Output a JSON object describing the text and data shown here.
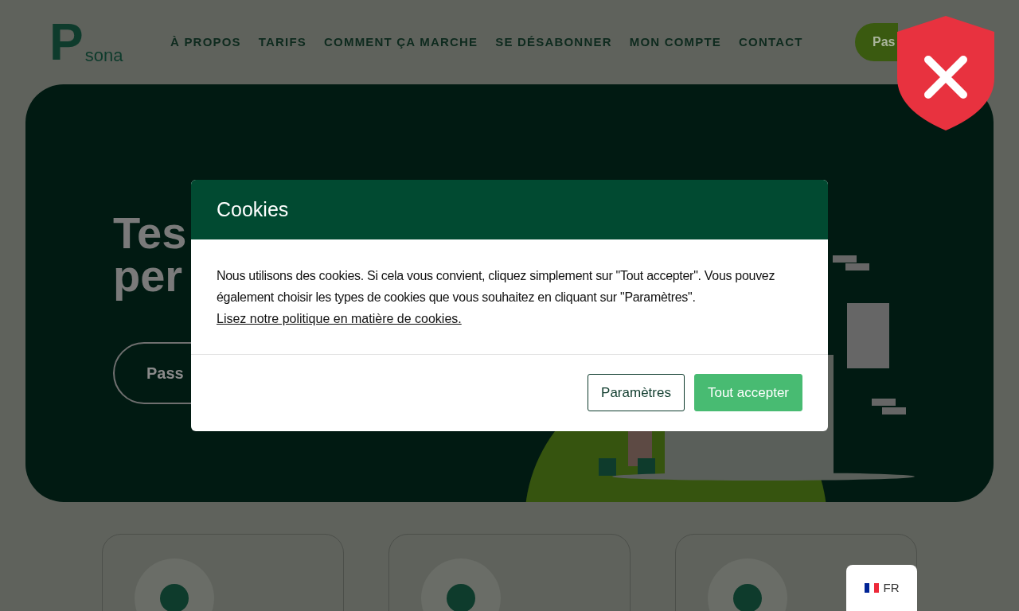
{
  "header": {
    "logo_mark": "P",
    "logo_text": "sona",
    "nav": [
      "À PROPOS",
      "TARIFS",
      "COMMENT ÇA MARCHE",
      "SE DÉSABONNER",
      "MON COMPTE",
      "CONTACT"
    ],
    "cta": "Pas"
  },
  "hero": {
    "title_lines": [
      "Tes",
      "per"
    ],
    "button": "Pass"
  },
  "cookie_dialog": {
    "title": "Cookies",
    "message": "Nous utilisons des cookies. Si cela vous convient, cliquez simplement sur \"Tout accepter\". Vous pouvez également choisir les types de cookies que vous souhaitez en cliquant sur \"Paramètres\".",
    "link": "Lisez notre politique en matière de cookies.",
    "buttons": [
      {
        "label": "Paramètres",
        "kind": "secondary"
      },
      {
        "label": "Tout accepter",
        "kind": "primary"
      }
    ]
  },
  "language": {
    "label": "FR"
  }
}
